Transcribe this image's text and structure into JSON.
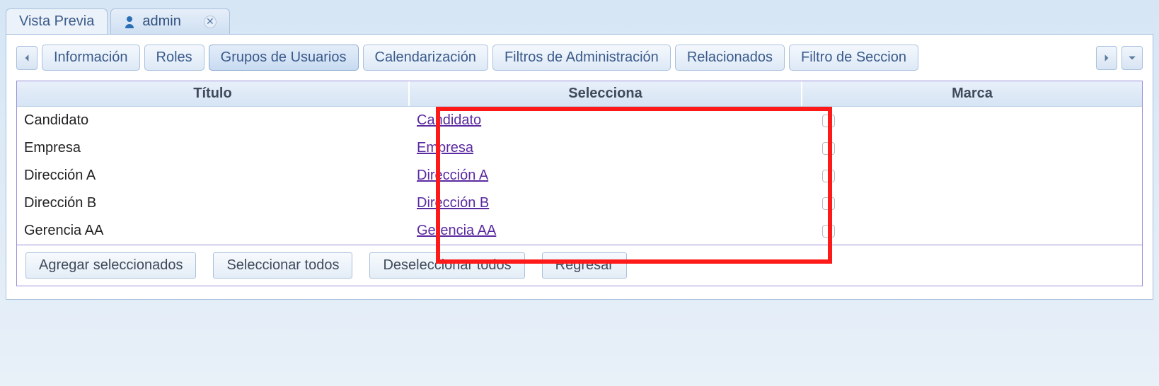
{
  "outer_tabs": {
    "preview": "Vista Previa",
    "admin": "admin"
  },
  "inner_tabs": [
    "Información",
    "Roles",
    "Grupos de Usuarios",
    "Calendarización",
    "Filtros de Administración",
    "Relacionados",
    "Filtro de Seccion"
  ],
  "inner_tabs_active_index": 2,
  "table": {
    "headers": {
      "title": "Título",
      "select": "Selecciona",
      "mark": "Marca"
    },
    "rows": [
      {
        "title": "Candidato",
        "select": "Candidato",
        "checked": false
      },
      {
        "title": "Empresa",
        "select": "Empresa",
        "checked": false
      },
      {
        "title": "Dirección A",
        "select": "Dirección A",
        "checked": false
      },
      {
        "title": "Dirección B",
        "select": "Dirección B",
        "checked": false
      },
      {
        "title": "Gerencia AA",
        "select": "Gerencia AA",
        "checked": false
      }
    ]
  },
  "buttons": {
    "add_selected": "Agregar seleccionados",
    "select_all": "Seleccionar todos",
    "deselect_all": "Deseleccionar todos",
    "back": "Regresar"
  }
}
